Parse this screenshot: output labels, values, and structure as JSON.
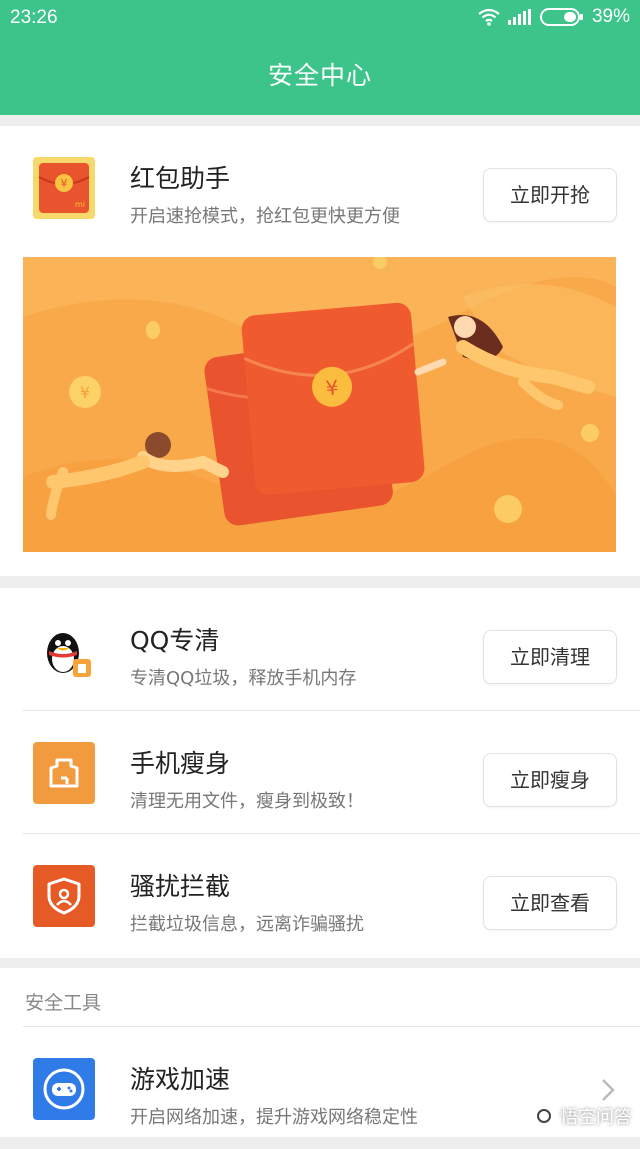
{
  "status_bar": {
    "time": "23:26",
    "battery": "39%"
  },
  "header": {
    "title": "安全中心"
  },
  "red_packet": {
    "title": "红包助手",
    "subtitle": "开启速抢模式，抢红包更快更方便",
    "button": "立即开抢",
    "icon": "red-envelope-icon",
    "icon_text": "mi"
  },
  "cleanup": [
    {
      "title": "QQ专清",
      "subtitle": "专清QQ垃圾，释放手机内存",
      "button": "立即清理",
      "icon": "qq-penguin-icon"
    },
    {
      "title": "手机瘦身",
      "subtitle": "清理无用文件，瘦身到极致！",
      "button": "立即瘦身",
      "icon": "broom-icon"
    },
    {
      "title": "骚扰拦截",
      "subtitle": "拦截垃圾信息，远离诈骗骚扰",
      "button": "立即查看",
      "icon": "shield-icon"
    }
  ],
  "tools": {
    "section_label": "安全工具",
    "items": [
      {
        "title": "游戏加速",
        "subtitle": "开启网络加速，提升游戏网络稳定性",
        "icon": "gamepad-icon"
      }
    ]
  },
  "colors": {
    "accent_green": "#3cc48b",
    "banner_orange": "#f9a94a",
    "envelope_red": "#e9532d"
  },
  "watermark": {
    "text": "悟空问答"
  }
}
